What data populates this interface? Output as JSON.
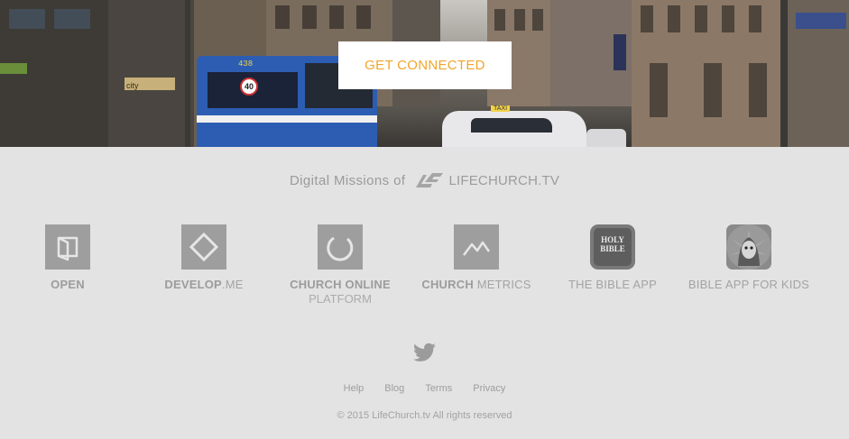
{
  "hero": {
    "cta_label": "GET CONNECTED",
    "bus_route": "438",
    "speed_sign": "40",
    "shop_sign": "city",
    "taxi_sign": "TAXI"
  },
  "missions": {
    "lead_text": "Digital Missions of",
    "brand_name": "LIFECHURCH.TV"
  },
  "apps": [
    {
      "id": "open",
      "bold": "OPEN",
      "light": "",
      "sub": "",
      "icon": "open-door-icon"
    },
    {
      "id": "develop",
      "bold": "DEVELOP",
      "light": ".ME",
      "sub": "",
      "icon": "diamond-icon"
    },
    {
      "id": "church-online",
      "bold": "CHURCH ONLINE",
      "light": "",
      "sub": "PLATFORM",
      "icon": "circle-icon"
    },
    {
      "id": "church-metrics",
      "bold": "CHURCH",
      "light": " METRICS",
      "sub": "",
      "icon": "line-graph-icon"
    },
    {
      "id": "bible-app",
      "bold": "",
      "light": "THE BIBLE APP",
      "sub": "",
      "icon": "holy-bible-icon",
      "icon_text": [
        "HOLY",
        "BIBLE"
      ]
    },
    {
      "id": "bible-app-kids",
      "bold": "",
      "light": "BIBLE APP FOR KIDS",
      "sub": "",
      "icon": "kids-character-icon"
    }
  ],
  "footer": {
    "links": [
      "Help",
      "Blog",
      "Terms",
      "Privacy"
    ],
    "copyright": "© 2015 LifeChurch.tv All rights reserved"
  },
  "colors": {
    "background": "#e3e3e3",
    "accent": "#f0a52c",
    "tile": "#9e9e9e",
    "text": "#9a9a9a"
  }
}
